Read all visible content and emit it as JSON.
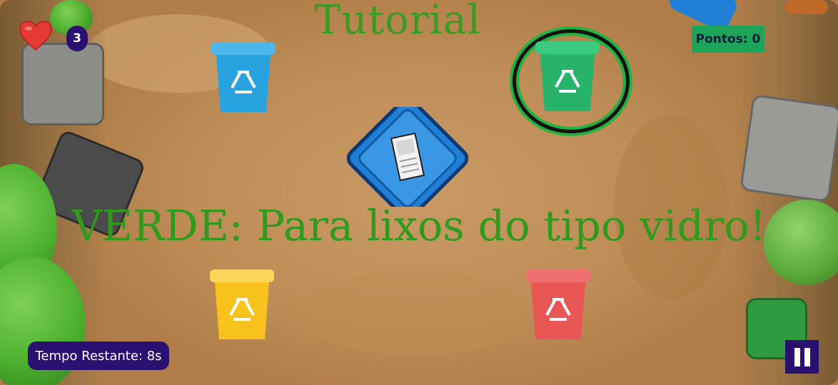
{
  "game": {
    "title": "Tutorial",
    "lives": "3",
    "score_label": "Pontos: 0",
    "hint": "VERDE: Para lixos do tipo vidro!",
    "timer": "Tempo Restante: 8s"
  },
  "bins": [
    {
      "color_name": "blue",
      "color": "#29a3e0",
      "lid": "#4ab6ea",
      "icon": "recycle-icon"
    },
    {
      "color_name": "green",
      "color": "#27b36a",
      "lid": "#3ccb7e",
      "icon": "recycle-icon",
      "highlighted": true
    },
    {
      "color_name": "yellow",
      "color": "#f7c21b",
      "lid": "#fbd45a",
      "icon": "recycle-icon"
    },
    {
      "color_name": "red",
      "color": "#e85656",
      "lid": "#ef7070",
      "icon": "recycle-icon"
    }
  ],
  "current_item": {
    "icon": "newspaper-icon",
    "tile_color": "#1f7fd6"
  },
  "icons": {
    "lives": "heart-icon",
    "pause": "pause-icon"
  },
  "colors": {
    "title_green": "#3a9a22",
    "badge_purple": "#2a1070",
    "score_bg": "#1ea35a",
    "dirt": "#c99a66"
  }
}
